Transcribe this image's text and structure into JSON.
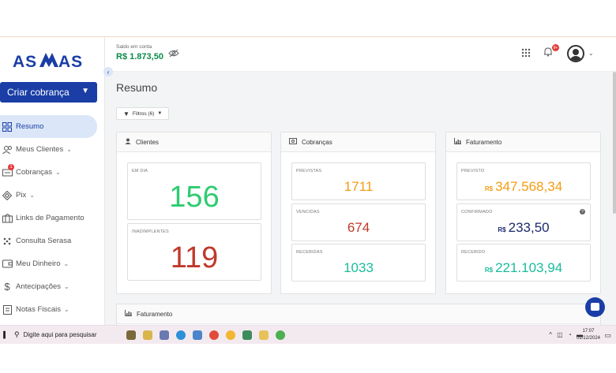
{
  "brand": {
    "logo_text": "ASAAS",
    "logo_color": "#1a3ea6"
  },
  "topbar": {
    "saldo_label": "Saldo em conta",
    "saldo_value": "R$ 1.873,50",
    "notification_count": "9+"
  },
  "sidebar": {
    "create_button": "Criar cobrança",
    "items": [
      {
        "label": "Resumo",
        "icon": "grid-icon",
        "active": true
      },
      {
        "label": "Meus Clientes",
        "icon": "users-icon",
        "caret": true
      },
      {
        "label": "Cobranças",
        "icon": "invoice-icon",
        "caret": true,
        "badge": "1"
      },
      {
        "label": "Pix",
        "icon": "pix-icon",
        "caret": true
      },
      {
        "label": "Links de Pagamento",
        "icon": "link-icon"
      },
      {
        "label": "Consulta Serasa",
        "icon": "serasa-icon"
      },
      {
        "label": "Meu Dinheiro",
        "icon": "wallet-icon",
        "caret": true
      },
      {
        "label": "Antecipações",
        "icon": "dollar-icon",
        "caret": true
      },
      {
        "label": "Notas Fiscais",
        "icon": "receipt-icon",
        "caret": true
      }
    ]
  },
  "main": {
    "title": "Resumo",
    "filter_label": "Filtros (6)",
    "clientes": {
      "title": "Clientes",
      "em_dia_label": "EM DIA",
      "em_dia_value": "156",
      "inadimplentes_label": "INADIMPLENTES",
      "inadimplentes_value": "119"
    },
    "cobrancas": {
      "title": "Cobranças",
      "previstas_label": "PREVISTAS",
      "previstas_value": "1711",
      "vencidas_label": "VENCIDAS",
      "vencidas_value": "674",
      "recebidas_label": "RECEBIDAS",
      "recebidas_value": "1033"
    },
    "faturamento": {
      "title": "Faturamento",
      "currency": "R$",
      "previsto_label": "PREVISTO",
      "previsto_value": "347.568,34",
      "confirmado_label": "CONFIRMADO",
      "confirmado_value": "233,50",
      "recebido_label": "RECEBIDO",
      "recebido_value": "221.103,94"
    },
    "faturamento_bottom_title": "Faturamento"
  },
  "taskbar": {
    "search_placeholder": "Digite aqui para pesquisar",
    "time": "17:07",
    "date": "09/12/2024"
  },
  "colors": {
    "green": "#2ecc71",
    "orange": "#f39c12",
    "red": "#c0392b",
    "navy": "#1c2a6b",
    "teal": "#1abc9c"
  }
}
